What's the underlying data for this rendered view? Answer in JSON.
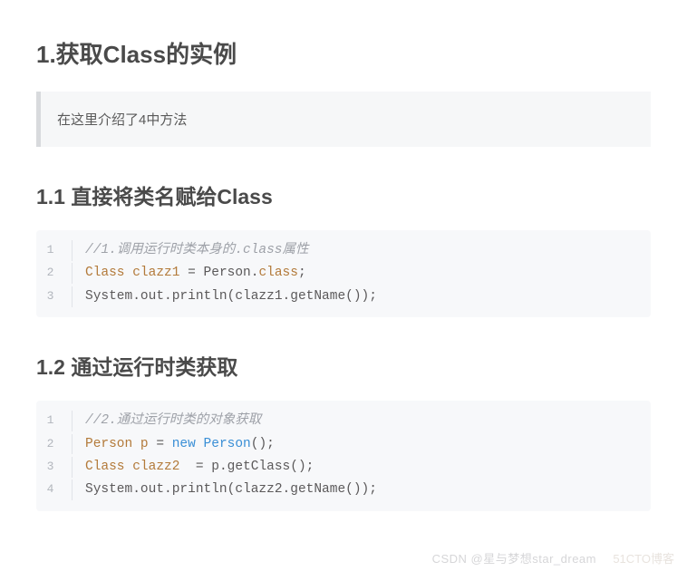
{
  "heading1": "1.获取Class的实例",
  "quote": "在这里介绍了4中方法",
  "section1": {
    "heading": "1.1 直接将类名赋给Class",
    "code": [
      {
        "n": "1",
        "tokens": [
          {
            "cls": "tok-comment",
            "t": "//1.调用运行时类本身的.class属性"
          }
        ]
      },
      {
        "n": "2",
        "tokens": [
          {
            "cls": "tok-type",
            "t": "Class"
          },
          {
            "cls": "tok-plain",
            "t": " "
          },
          {
            "cls": "tok-var",
            "t": "clazz1"
          },
          {
            "cls": "tok-plain",
            "t": " = Person."
          },
          {
            "cls": "tok-keyword",
            "t": "class"
          },
          {
            "cls": "tok-plain",
            "t": ";"
          }
        ]
      },
      {
        "n": "3",
        "tokens": [
          {
            "cls": "tok-plain",
            "t": "System.out.println(clazz1.getName());"
          }
        ]
      }
    ]
  },
  "section2": {
    "heading": "1.2 通过运行时类获取",
    "code": [
      {
        "n": "1",
        "tokens": [
          {
            "cls": "tok-comment",
            "t": "//2.通过运行时类的对象获取"
          }
        ]
      },
      {
        "n": "2",
        "tokens": [
          {
            "cls": "tok-type",
            "t": "Person"
          },
          {
            "cls": "tok-plain",
            "t": " "
          },
          {
            "cls": "tok-var",
            "t": "p"
          },
          {
            "cls": "tok-plain",
            "t": " = "
          },
          {
            "cls": "tok-new",
            "t": "new"
          },
          {
            "cls": "tok-plain",
            "t": " "
          },
          {
            "cls": "tok-class",
            "t": "Person"
          },
          {
            "cls": "tok-plain",
            "t": "();"
          }
        ]
      },
      {
        "n": "3",
        "tokens": [
          {
            "cls": "tok-type",
            "t": "Class"
          },
          {
            "cls": "tok-plain",
            "t": " "
          },
          {
            "cls": "tok-var",
            "t": "clazz2"
          },
          {
            "cls": "tok-plain",
            "t": "  = p.getClass();"
          }
        ]
      },
      {
        "n": "4",
        "tokens": [
          {
            "cls": "tok-plain",
            "t": "System.out.println(clazz2.getName());"
          }
        ]
      }
    ]
  },
  "watermark1": "CSDN @星与梦想star_dream",
  "watermark2": "51CTO博客"
}
